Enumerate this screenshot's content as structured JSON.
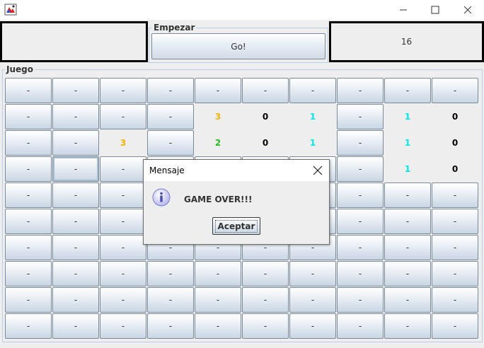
{
  "window": {
    "icon": "minesweeper-app-icon",
    "controls": [
      "minimize-icon",
      "maximize-icon",
      "close-icon"
    ]
  },
  "top_panel": {
    "left_display": "",
    "start_group_title": "Empezar",
    "go_button_label": "Go!",
    "counter_value": "16"
  },
  "game_panel": {
    "title": "Juego",
    "rows": [
      [
        "-",
        "-",
        "-",
        "-",
        "-",
        "-",
        "-",
        "-",
        "-",
        "-"
      ],
      [
        "-",
        "-",
        "-",
        "-",
        "3",
        "0",
        "1",
        "-",
        "1",
        "0"
      ],
      [
        "-",
        "-",
        "3",
        "-",
        "2",
        "0",
        "1",
        "-",
        "1",
        "0"
      ],
      [
        "-",
        "-",
        "-",
        "",
        "",
        "",
        "",
        "-",
        "1",
        "0"
      ],
      [
        "-",
        "-",
        "-",
        "",
        "",
        "",
        "",
        "-",
        "-",
        "-"
      ],
      [
        "-",
        "-",
        "-",
        "",
        "",
        "",
        "",
        "-",
        "-",
        "-"
      ],
      [
        "-",
        "-",
        "-",
        "-",
        "-",
        "-",
        "-",
        "-",
        "-",
        "-"
      ],
      [
        "-",
        "-",
        "-",
        "-",
        "-",
        "-",
        "-",
        "-",
        "-",
        "-"
      ],
      [
        "-",
        "-",
        "-",
        "-",
        "-",
        "-",
        "-",
        "-",
        "-",
        "-"
      ],
      [
        "-",
        "-",
        "-",
        "-",
        "-",
        "-",
        "-",
        "-",
        "-",
        "-"
      ]
    ],
    "revealed": [
      [
        1,
        4
      ],
      [
        1,
        5
      ],
      [
        1,
        6
      ],
      [
        1,
        8
      ],
      [
        1,
        9
      ],
      [
        2,
        2
      ],
      [
        2,
        4
      ],
      [
        2,
        5
      ],
      [
        2,
        6
      ],
      [
        2,
        8
      ],
      [
        2,
        9
      ],
      [
        3,
        8
      ],
      [
        3,
        9
      ]
    ],
    "focused_cell": [
      3,
      1
    ],
    "number_colors": {
      "0": "#000000",
      "1": "#00e5e5",
      "2": "#22bb22",
      "3": "#f0b400"
    }
  },
  "dialog": {
    "title": "Mensaje",
    "icon": "info-icon",
    "message": "GAME OVER!!!",
    "button_label": "Aceptar"
  }
}
